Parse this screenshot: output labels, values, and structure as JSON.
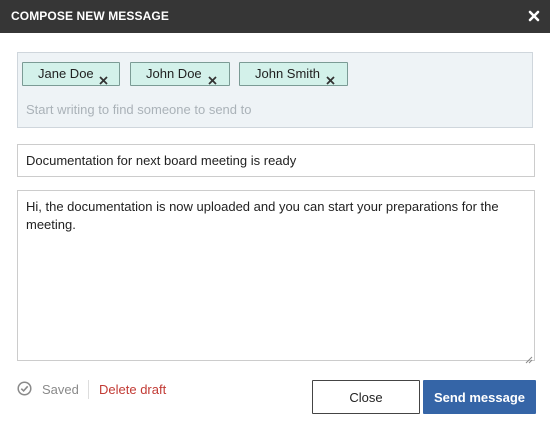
{
  "dialog": {
    "title": "COMPOSE NEW MESSAGE",
    "close_icon": "close-icon"
  },
  "recipients": {
    "chips": [
      {
        "label": "Jane Doe",
        "remove_icon": "remove-icon"
      },
      {
        "label": "John Doe",
        "remove_icon": "remove-icon"
      },
      {
        "label": "John Smith",
        "remove_icon": "remove-icon"
      }
    ],
    "placeholder": "Start writing to find someone to send to"
  },
  "subject": {
    "value": "Documentation for next board meeting is ready"
  },
  "body": {
    "value": "Hi, the documentation is now uploaded and you can start your preparations for the meeting."
  },
  "footer": {
    "saved_icon": "check-circle-icon",
    "saved_label": "Saved",
    "delete_draft_label": "Delete draft",
    "close_label": "Close",
    "send_label": "Send message"
  },
  "colors": {
    "titlebar": "#363636",
    "chip_background": "#d3f1ea",
    "recipients_background": "#eef3f6",
    "delete_draft": "#c23b35",
    "primary_button": "#3565a7"
  }
}
